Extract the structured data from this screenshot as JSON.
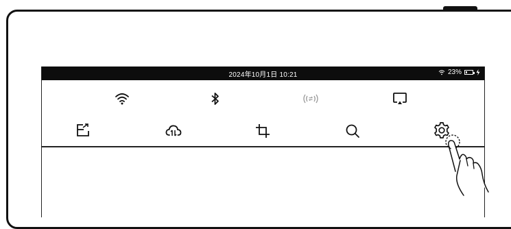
{
  "status_bar": {
    "datetime": "2024年10月1日 10:21",
    "battery_percent": "23%",
    "battery_level": 0.23,
    "icons": [
      "wifi-icon",
      "battery-icon",
      "charging-icon"
    ]
  },
  "quick_toggles": [
    {
      "name": "wifi-toggle",
      "icon": "wifi-icon"
    },
    {
      "name": "bluetooth-toggle",
      "icon": "bluetooth-icon"
    },
    {
      "name": "hotspot-toggle",
      "icon": "hotspot-icon",
      "disabled": true
    },
    {
      "name": "screen-cast-toggle",
      "icon": "screencast-icon"
    }
  ],
  "quick_actions": [
    {
      "name": "export-button",
      "icon": "export-icon"
    },
    {
      "name": "cloud-sync-button",
      "icon": "cloud-sync-icon"
    },
    {
      "name": "crop-button",
      "icon": "crop-icon"
    },
    {
      "name": "search-button",
      "icon": "search-icon"
    },
    {
      "name": "settings-button",
      "icon": "gear-icon",
      "highlighted_by_tap": true
    }
  ],
  "colors": {
    "frame": "#111111",
    "status_bar": "#0d0d0d",
    "disabled_icon": "#999999"
  }
}
